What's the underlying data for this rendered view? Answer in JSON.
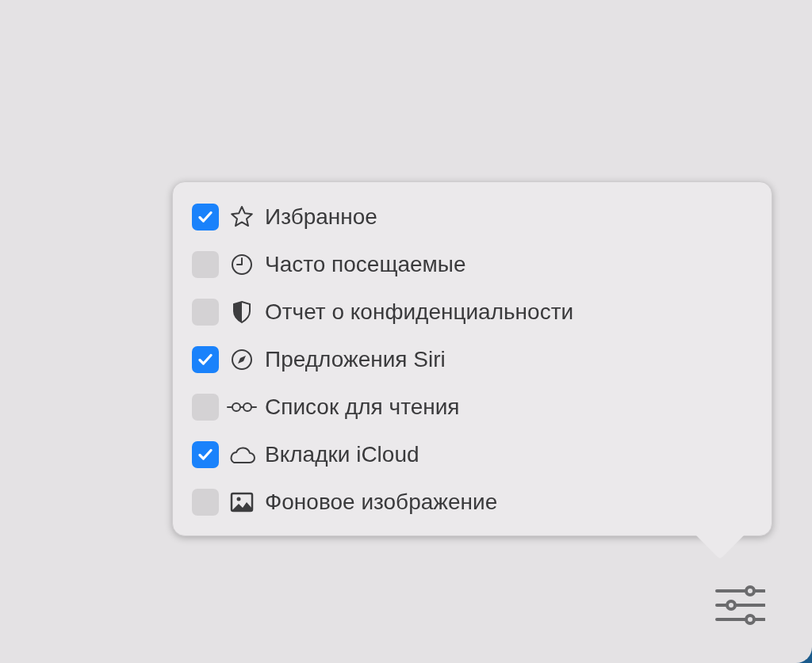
{
  "popover": {
    "items": [
      {
        "label": "Избранное",
        "checked": true
      },
      {
        "label": "Часто посещаемые",
        "checked": false
      },
      {
        "label": "Отчет о конфиденциальности",
        "checked": false
      },
      {
        "label": "Предложения Siri",
        "checked": true
      },
      {
        "label": "Список для чтения",
        "checked": false
      },
      {
        "label": "Вкладки iCloud",
        "checked": true
      },
      {
        "label": "Фоновое изображение",
        "checked": false
      }
    ]
  }
}
